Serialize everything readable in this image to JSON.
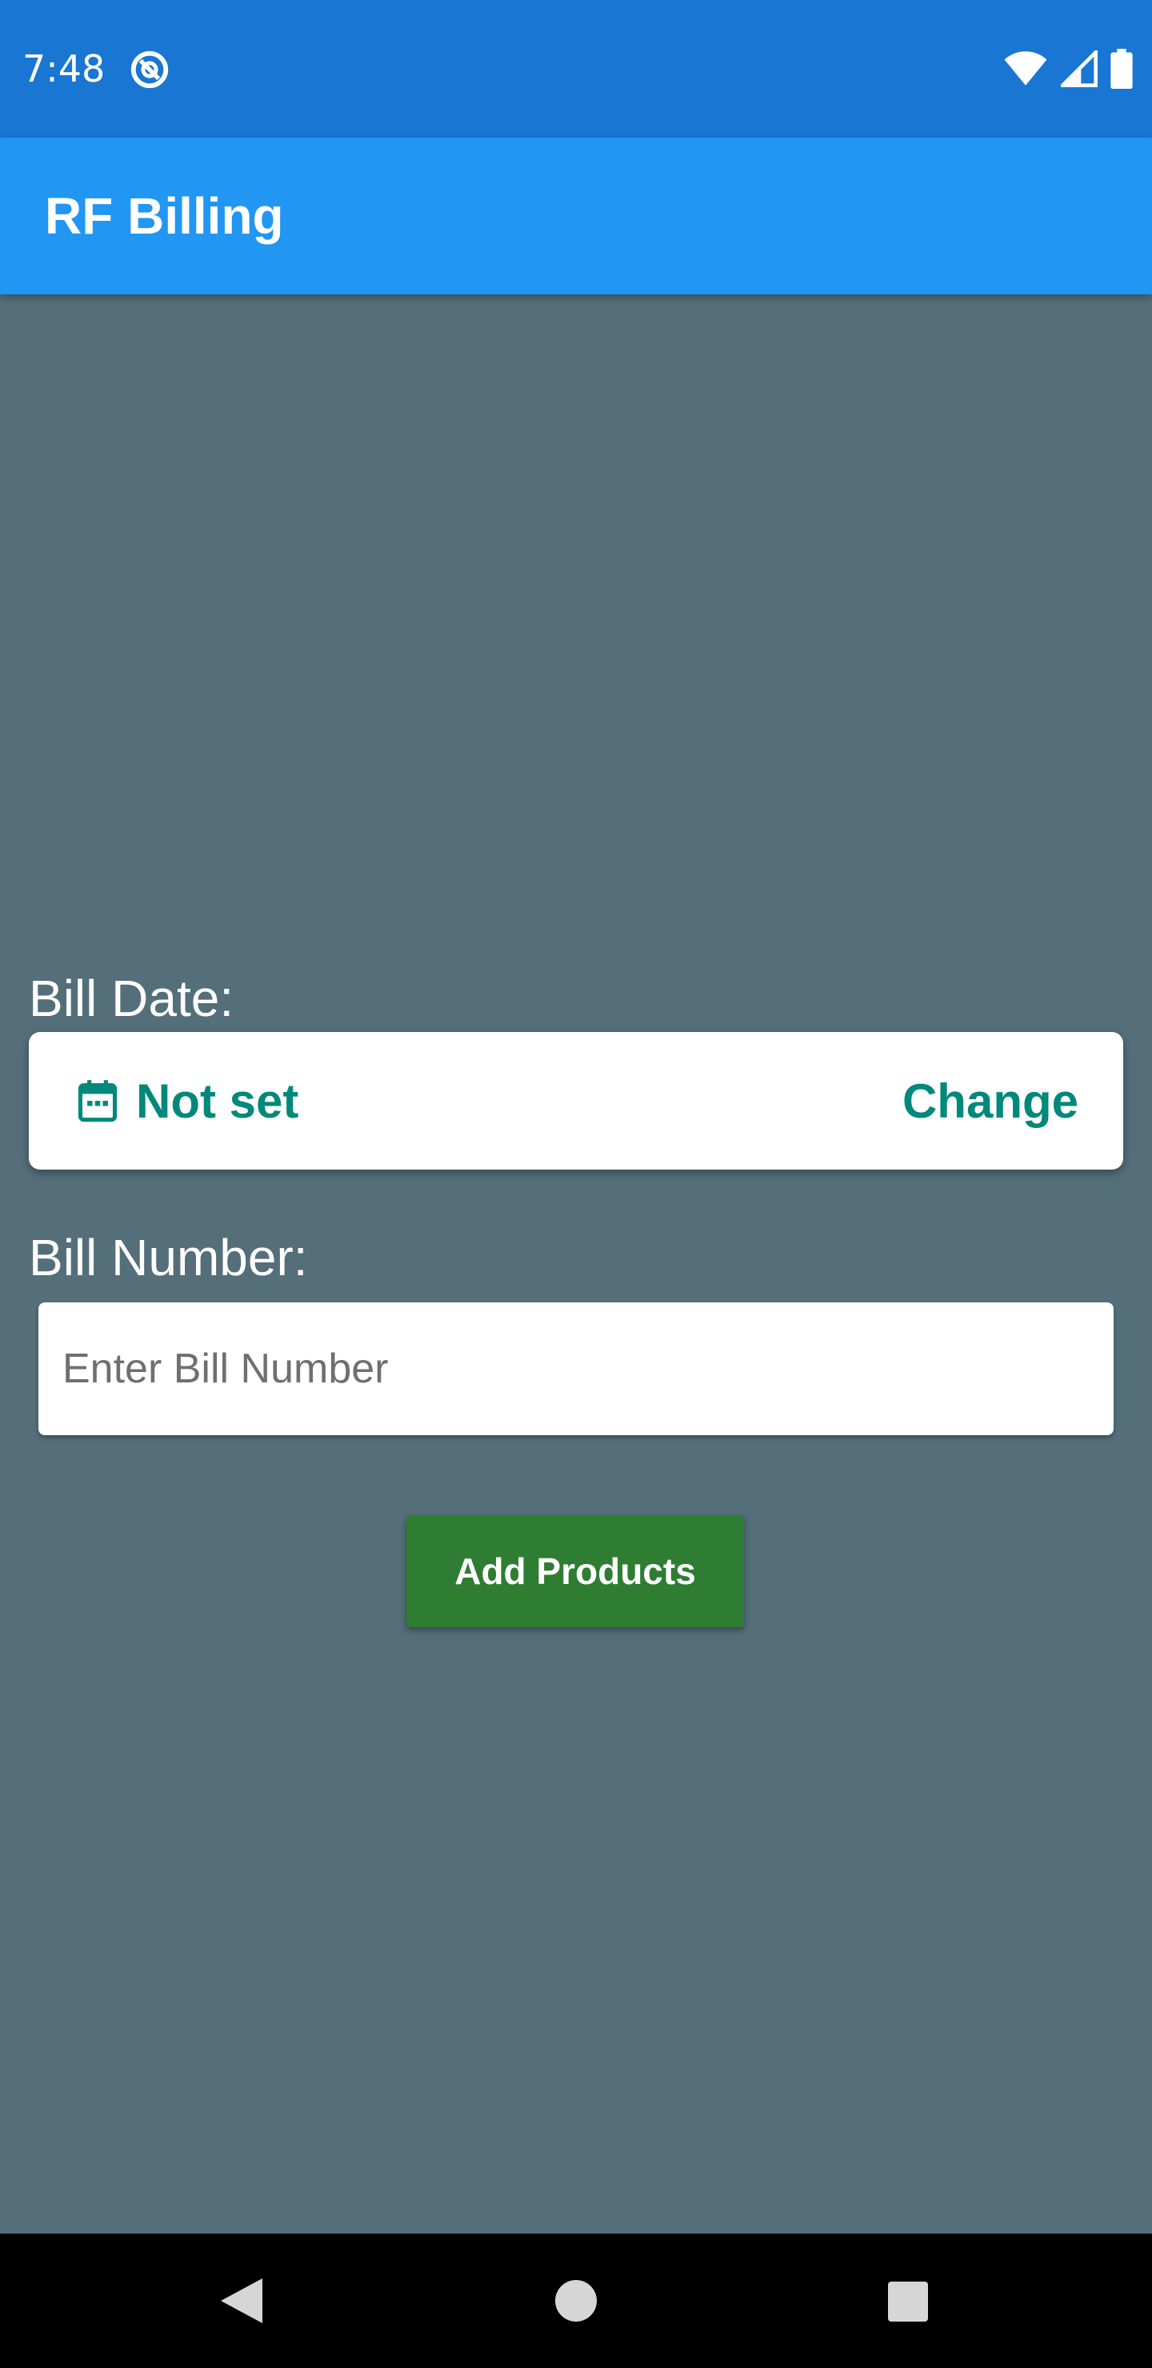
{
  "status_bar": {
    "time": "7:48",
    "icons": [
      "sync-icon",
      "wifi-icon",
      "signal-icon",
      "battery-icon"
    ]
  },
  "app_bar": {
    "title": "RF Billing"
  },
  "form": {
    "bill_date_label": "Bill Date:",
    "bill_date_value": "Not set",
    "change_label": "Change",
    "bill_number_label": "Bill Number:",
    "bill_number_placeholder": "Enter Bill Number",
    "bill_number_value": "",
    "add_products_label": "Add Products"
  },
  "nav_bar": {
    "icons": [
      "back-icon",
      "home-icon",
      "recents-icon"
    ]
  },
  "colors": {
    "status_bar": "#1976D2",
    "app_bar": "#2196F3",
    "background": "#546E7A",
    "accent_teal": "#00897B",
    "button_green": "#2E7D32"
  }
}
